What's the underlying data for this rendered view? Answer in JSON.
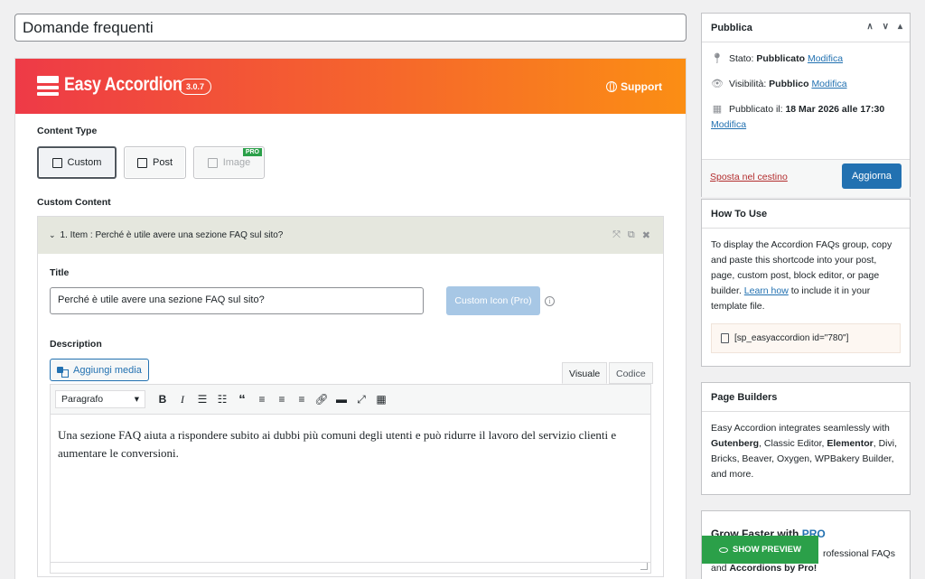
{
  "post_title": "Domande frequenti",
  "plugin": {
    "name": "Easy Accordion",
    "version": "3.0.7",
    "support_label": "Support"
  },
  "content_type": {
    "label": "Content Type",
    "options": [
      "Custom",
      "Post",
      "Image"
    ],
    "selected": "Custom",
    "pro_badge": "PRO"
  },
  "custom_content": {
    "label": "Custom Content",
    "item_header": "1. Item : Perché è utile avere una sezione FAQ sul sito?",
    "title_label": "Title",
    "title_value": "Perché è utile avere una sezione FAQ sul sito?",
    "custom_icon_label": "Custom Icon (Pro)",
    "description_label": "Description",
    "add_media_label": "Aggiungi media",
    "tab_visual": "Visuale",
    "tab_code": "Codice",
    "format_select": "Paragrafo",
    "content": "Una sezione FAQ aiuta a rispondere subito ai dubbi più comuni degli utenti e può ridurre il lavoro del servizio clienti e aumentare le conversioni."
  },
  "publish": {
    "title": "Pubblica",
    "status_label": "Stato: ",
    "status_value": "Pubblicato",
    "visibility_label": "Visibilità: ",
    "visibility_value": "Pubblico",
    "published_label": "Pubblicato il: ",
    "published_value": "18 Mar 2026 alle 17:30",
    "edit_link": "Modifica",
    "trash_link": "Sposta nel cestino",
    "update_button": "Aggiorna"
  },
  "how_to_use": {
    "title": "How To Use",
    "text_before": "To display the Accordion FAQs group, copy and paste this shortcode into your post, page, custom post, block editor, or page builder. ",
    "learn_link": "Learn how",
    "text_after": " to include it in your template file.",
    "shortcode": "[sp_easyaccordion id=\"780\"]"
  },
  "page_builders": {
    "title": "Page Builders",
    "text_1": "Easy Accordion integrates seamlessly with ",
    "gutenberg": "Gutenberg",
    "text_2": ", Classic Editor, ",
    "elementor": "Elementor",
    "text_3": ", Divi, Bricks, Beaver, Oxygen, WPBakery Builder, and more."
  },
  "grow": {
    "title_prefix": "Grow Faster with ",
    "title_pro": "PRO",
    "text_visible": "rofessional FAQs",
    "text_line2_a": "and ",
    "text_line2_b": "Accordions by Pro!"
  },
  "show_preview": "SHOW PREVIEW"
}
